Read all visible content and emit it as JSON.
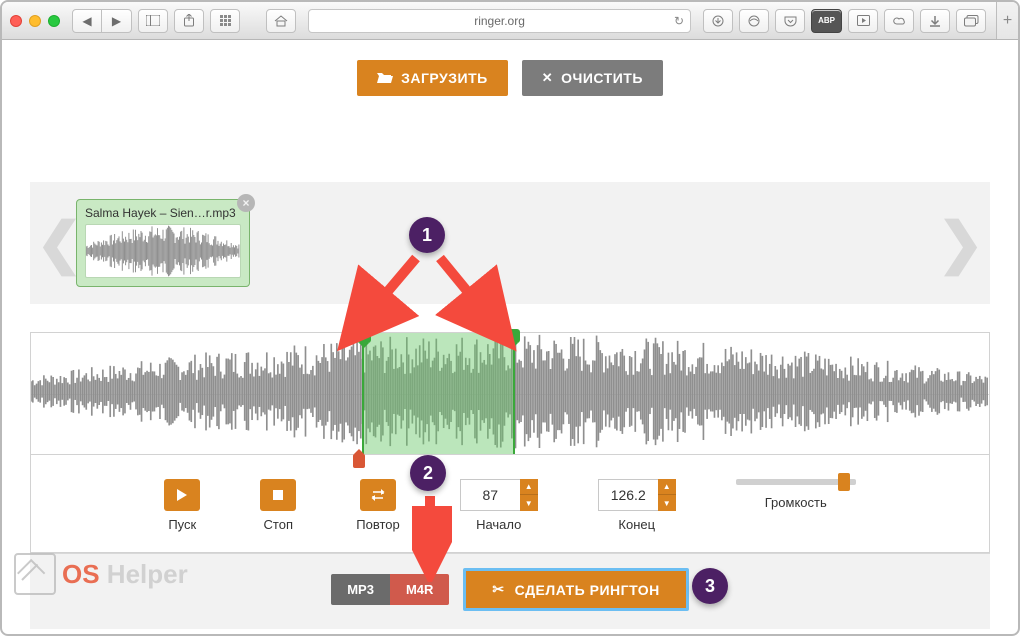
{
  "browser": {
    "url": "ringer.org"
  },
  "actions": {
    "upload_label": "ЗАГРУЗИТЬ",
    "clear_label": "ОЧИСТИТЬ"
  },
  "file": {
    "name": "Salma Hayek – Sien…r.mp3"
  },
  "selection": {
    "start_pct": 34.5,
    "end_pct": 50.5,
    "playhead_pct": 34.2
  },
  "controls": {
    "play_label": "Пуск",
    "stop_label": "Стоп",
    "repeat_label": "Повтор",
    "start_label": "Начало",
    "end_label": "Конец",
    "volume_label": "Громкость",
    "start_value": "87",
    "end_value": "126.2"
  },
  "format": {
    "a": "MP3",
    "b": "M4R"
  },
  "cta_label": "СДЕЛАТЬ РИНГТОН",
  "annotations": {
    "b1": "1",
    "b2": "2",
    "b3": "3"
  },
  "watermark": {
    "a": "OS",
    "b": " Helper"
  },
  "colors": {
    "accent": "#d9831f",
    "select": "#3aa83a",
    "bubble": "#4c2064"
  }
}
